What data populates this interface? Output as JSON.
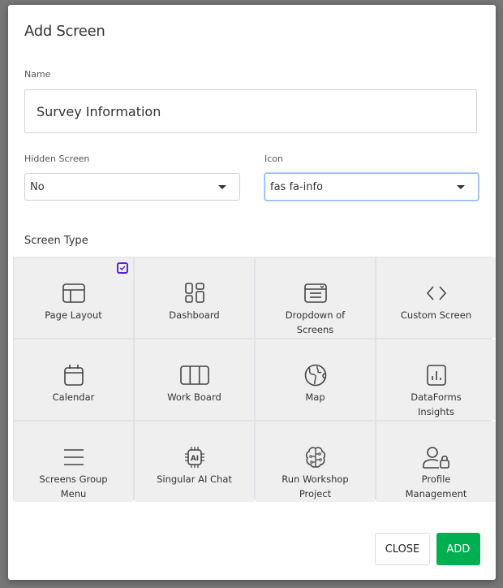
{
  "dialog": {
    "title": "Add Screen"
  },
  "form": {
    "name": {
      "label": "Name",
      "value": "Survey Information"
    },
    "hidden_screen": {
      "label": "Hidden Screen",
      "value": "No"
    },
    "icon": {
      "label": "Icon",
      "value": "fas fa-info"
    },
    "screen_type": {
      "label": "Screen Type",
      "selected": "Page Layout",
      "options": [
        {
          "label": "Page Layout",
          "icon": "page-layout-icon",
          "selected": true
        },
        {
          "label": "Dashboard",
          "icon": "dashboard-icon",
          "selected": false
        },
        {
          "label": "Dropdown of Screens",
          "icon": "dropdown-window-icon",
          "selected": false
        },
        {
          "label": "Custom Screen",
          "icon": "code-icon",
          "selected": false
        },
        {
          "label": "Calendar",
          "icon": "calendar-icon",
          "selected": false
        },
        {
          "label": "Work Board",
          "icon": "columns-icon",
          "selected": false
        },
        {
          "label": "Map",
          "icon": "globe-icon",
          "selected": false
        },
        {
          "label": "DataForms Insights",
          "icon": "bar-chart-icon",
          "selected": false
        },
        {
          "label": "Screens Group Menu",
          "icon": "menu-icon",
          "selected": false
        },
        {
          "label": "Singular AI Chat",
          "icon": "ai-chip-icon",
          "selected": false
        },
        {
          "label": "Run Workshop Project",
          "icon": "brain-circuit-icon",
          "selected": false
        },
        {
          "label": "Profile Management",
          "icon": "user-lock-icon",
          "selected": false
        }
      ]
    }
  },
  "actions": {
    "close_label": "CLOSE",
    "add_label": "ADD"
  },
  "colors": {
    "accent_check": "#5a1ee8",
    "primary_button": "#00b050",
    "focus_border": "#8ab8f0"
  }
}
